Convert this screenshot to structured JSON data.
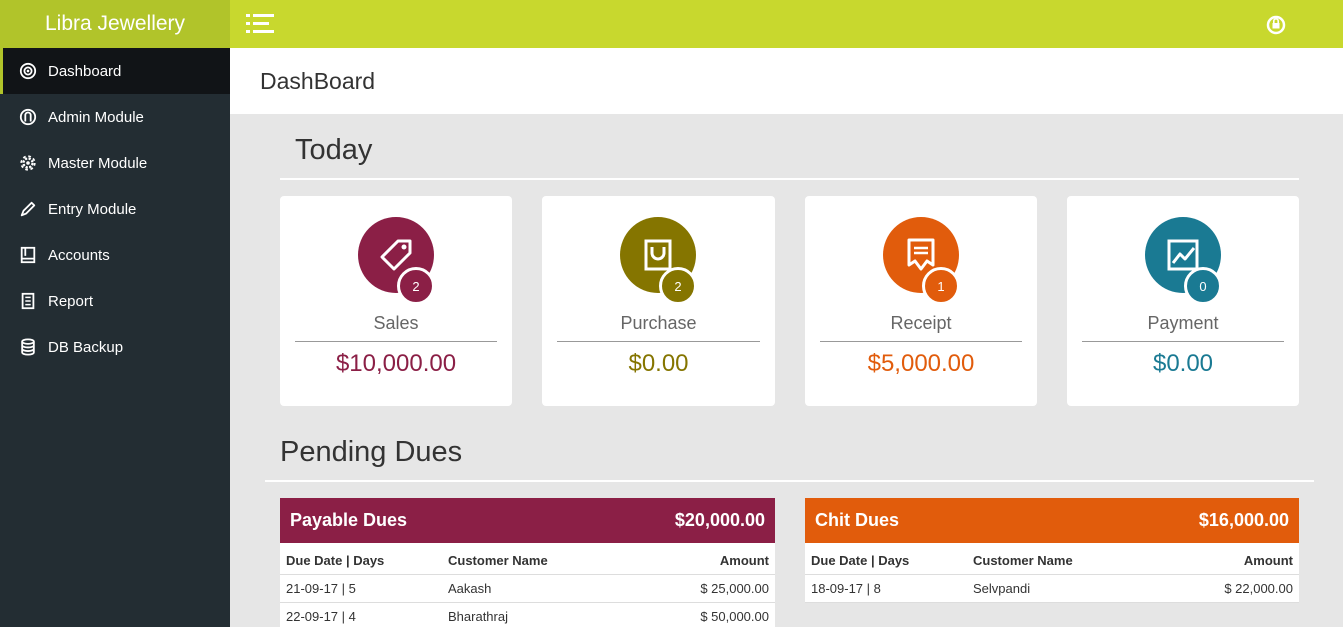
{
  "app": {
    "brand": "Libra Jewellery"
  },
  "sidebar": {
    "items": [
      {
        "label": "Dashboard",
        "icon": "dashboard-icon"
      },
      {
        "label": "Admin Module",
        "icon": "admin-icon"
      },
      {
        "label": "Master Module",
        "icon": "gear-icon"
      },
      {
        "label": "Entry Module",
        "icon": "pencil-icon"
      },
      {
        "label": "Accounts",
        "icon": "book-icon"
      },
      {
        "label": "Report",
        "icon": "report-icon"
      },
      {
        "label": "DB Backup",
        "icon": "database-icon"
      }
    ]
  },
  "header": {
    "title": "DashBoard"
  },
  "today": {
    "title": "Today",
    "cards": [
      {
        "label": "Sales",
        "count": "2",
        "value": "$10,000.00",
        "color": "#8b1f46",
        "icon": "tag-icon"
      },
      {
        "label": "Purchase",
        "count": "2",
        "value": "$0.00",
        "color": "#857500",
        "icon": "shopping-bag-icon"
      },
      {
        "label": "Receipt",
        "count": "1",
        "value": "$5,000.00",
        "color": "#e15c0c",
        "icon": "receipt-icon"
      },
      {
        "label": "Payment",
        "count": "0",
        "value": "$0.00",
        "color": "#1a7a93",
        "icon": "chart-icon"
      }
    ]
  },
  "pending": {
    "title": "Pending Dues",
    "payable": {
      "title": "Payable Dues",
      "total": "$20,000.00",
      "color": "#8b1f46",
      "columns": [
        "Due Date | Days",
        "Customer Name",
        "Amount"
      ],
      "rows": [
        {
          "date": "21-09-17",
          "days": "5",
          "name": "Aakash",
          "amount": "$ 25,000.00"
        },
        {
          "date": "22-09-17",
          "days": "4",
          "name": "Bharathraj",
          "amount": "$ 50,000.00"
        }
      ]
    },
    "chit": {
      "title": "Chit Dues",
      "total": "$16,000.00",
      "color": "#e15c0c",
      "columns": [
        "Due Date | Days",
        "Customer Name",
        "Amount"
      ],
      "rows": [
        {
          "date": "18-09-17",
          "days": "8",
          "name": "Selvpandi",
          "amount": "$ 22,000.00"
        }
      ]
    }
  }
}
